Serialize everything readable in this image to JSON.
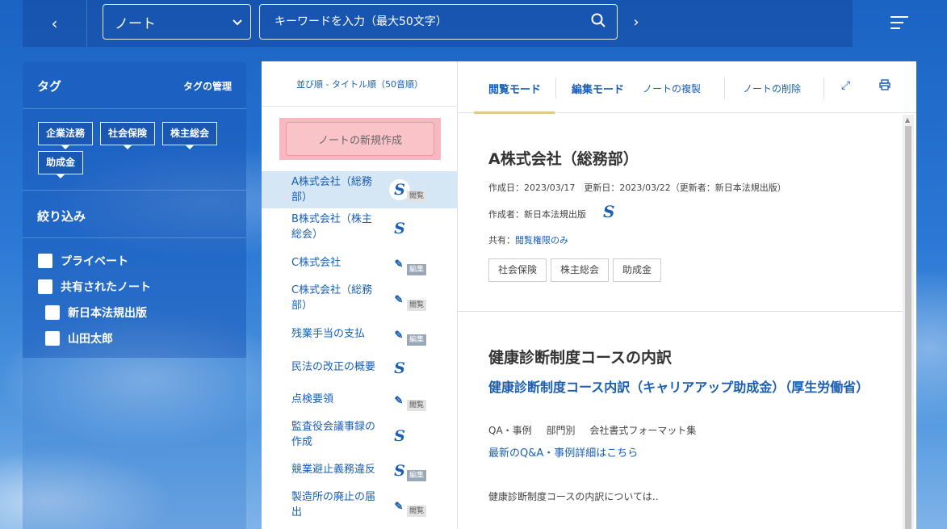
{
  "topbar": {
    "back_icon": "chevron-left-icon",
    "category_select": "ノート",
    "search_placeholder": "キーワードを入力（最大50文字）",
    "forward_icon": "chevron-right-icon",
    "menu_icon": "hamburger-icon"
  },
  "sidebar": {
    "tags_heading": "タグ",
    "tags_manage": "タグの管理",
    "tags": [
      "企業法務",
      "社会保険",
      "株主総会",
      "助成金"
    ],
    "filter_heading": "絞り込み",
    "filters": [
      "プライベート",
      "共有されたノート",
      "新日本法規出版",
      "山田太郎"
    ]
  },
  "list": {
    "sort_label": "並び順 - タイトル順（50音順）",
    "new_note_label": "ノートの新規作成",
    "items": [
      {
        "title": "A株式会社（総務部）",
        "badge": "閲覧",
        "icon": "logo"
      },
      {
        "title": "B株式会社（株主総会）",
        "badge": "",
        "icon": "logo"
      },
      {
        "title": "C株式会社",
        "badge": "編集",
        "icon": "pen"
      },
      {
        "title": "C株式会社（総務部）",
        "badge": "閲覧",
        "icon": "pen"
      },
      {
        "title": "残業手当の支払",
        "badge": "編集",
        "icon": "pen"
      },
      {
        "title": "民法の改正の概要",
        "badge": "",
        "icon": "logo"
      },
      {
        "title": "点検要領",
        "badge": "閲覧",
        "icon": "pen"
      },
      {
        "title": "監査役会議事録の作成",
        "badge": "",
        "icon": "logo"
      },
      {
        "title": "競業避止義務違反",
        "badge": "編集",
        "icon": "logo"
      },
      {
        "title": "製造所の廃止の届出",
        "badge": "閲覧",
        "icon": "pen"
      }
    ]
  },
  "detail": {
    "tabs": {
      "view_mode": "閲覧モード",
      "edit_mode": "編集モード",
      "duplicate": "ノートの複製",
      "delete": "ノートの削除"
    },
    "title": "A株式会社（総務部）",
    "dates": "作成日：2023/03/17　更新日：2023/03/22（更新者：新日本法規出版）",
    "author": "作成者：新日本法規出版",
    "share_label": "共有：",
    "share_value": "閲覧権限のみ",
    "tags": [
      "社会保険",
      "株主総会",
      "助成金"
    ],
    "section_heading": "健康診断制度コースの内訳",
    "link_title": "健康診断制度コース内訳（キャリアアップ助成金）（厚生労働省）",
    "categories": [
      "QA・事例",
      "部門別",
      "会社書式フォーマット集"
    ],
    "more_link": "最新のQ&A・事例詳細はこちら",
    "body_text": "健康診断制度コースの内訳については‥"
  },
  "colors": {
    "accent": "#1a5fb4",
    "new_note_bg": "#f7b9bf",
    "active_row": "#d5e6f5",
    "tab_underline": "#e2c889"
  }
}
